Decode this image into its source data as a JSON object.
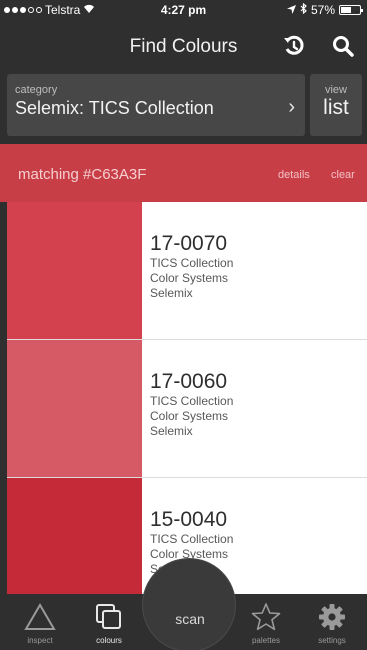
{
  "status": {
    "carrier": "Telstra",
    "time": "4:27 pm",
    "battery": "57%",
    "battery_level": 0.57
  },
  "nav": {
    "title": "Find Colours",
    "icons": [
      "history-icon",
      "search-icon"
    ]
  },
  "category": {
    "label": "category",
    "value": "Selemix: TICS Collection",
    "view_label": "view",
    "view_value": "list"
  },
  "matching": {
    "text": "matching #C63A3F",
    "details": "details",
    "clear": "clear",
    "color": "#c73e47"
  },
  "results": [
    {
      "code": "17-0070",
      "collection": "TICS Collection",
      "system": "Color Systems",
      "brand": "Selemix",
      "swatch": "#d2414d"
    },
    {
      "code": "17-0060",
      "collection": "TICS Collection",
      "system": "Color Systems",
      "brand": "Selemix",
      "swatch": "#d65a66"
    },
    {
      "code": "15-0040",
      "collection": "TICS Collection",
      "system": "Color Systems",
      "brand": "Selemix",
      "swatch": "#c52a39"
    }
  ],
  "tabs": {
    "inspect": "inspect",
    "colours": "colours",
    "scan": "scan",
    "palettes": "palettes",
    "settings": "settings"
  }
}
